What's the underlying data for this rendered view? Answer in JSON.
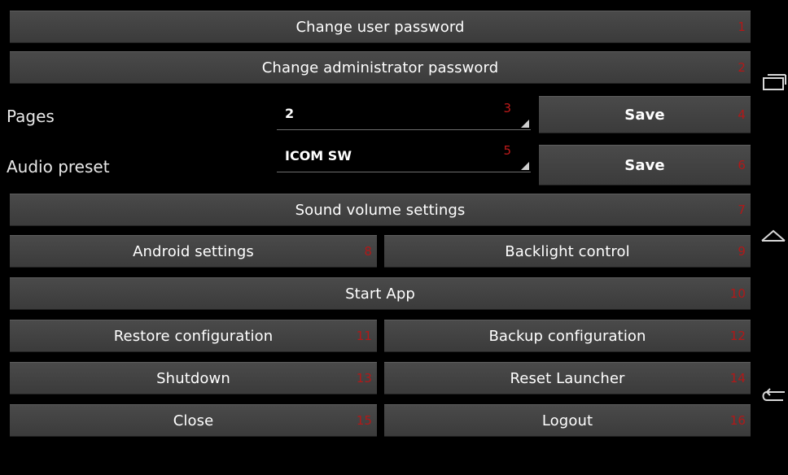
{
  "buttons": {
    "change_user_password": {
      "label": "Change user password",
      "num": "1"
    },
    "change_admin_password": {
      "label": "Change administrator password",
      "num": "2"
    },
    "pages_save": {
      "label": "Save",
      "num": "4"
    },
    "audio_save": {
      "label": "Save",
      "num": "6"
    },
    "sound_volume": {
      "label": "Sound volume settings",
      "num": "7"
    },
    "android_settings": {
      "label": "Android settings",
      "num": "8"
    },
    "backlight_control": {
      "label": "Backlight control",
      "num": "9"
    },
    "start_app": {
      "label": "Start App",
      "num": "10"
    },
    "restore_config": {
      "label": "Restore configuration",
      "num": "11"
    },
    "backup_config": {
      "label": "Backup configuration",
      "num": "12"
    },
    "shutdown": {
      "label": "Shutdown",
      "num": "13"
    },
    "reset_launcher": {
      "label": "Reset Launcher",
      "num": "14"
    },
    "close": {
      "label": "Close",
      "num": "15"
    },
    "logout": {
      "label": "Logout",
      "num": "16"
    }
  },
  "pages": {
    "label": "Pages",
    "value": "2",
    "num": "3"
  },
  "audio_preset": {
    "label": "Audio preset",
    "value": "ICOM SW",
    "num": "5"
  },
  "nav": {
    "icons": [
      "recent-apps-icon",
      "home-icon",
      "back-icon"
    ]
  },
  "colors": {
    "button_bg": "#434343",
    "number_red": "#b21818",
    "background": "#000000"
  }
}
